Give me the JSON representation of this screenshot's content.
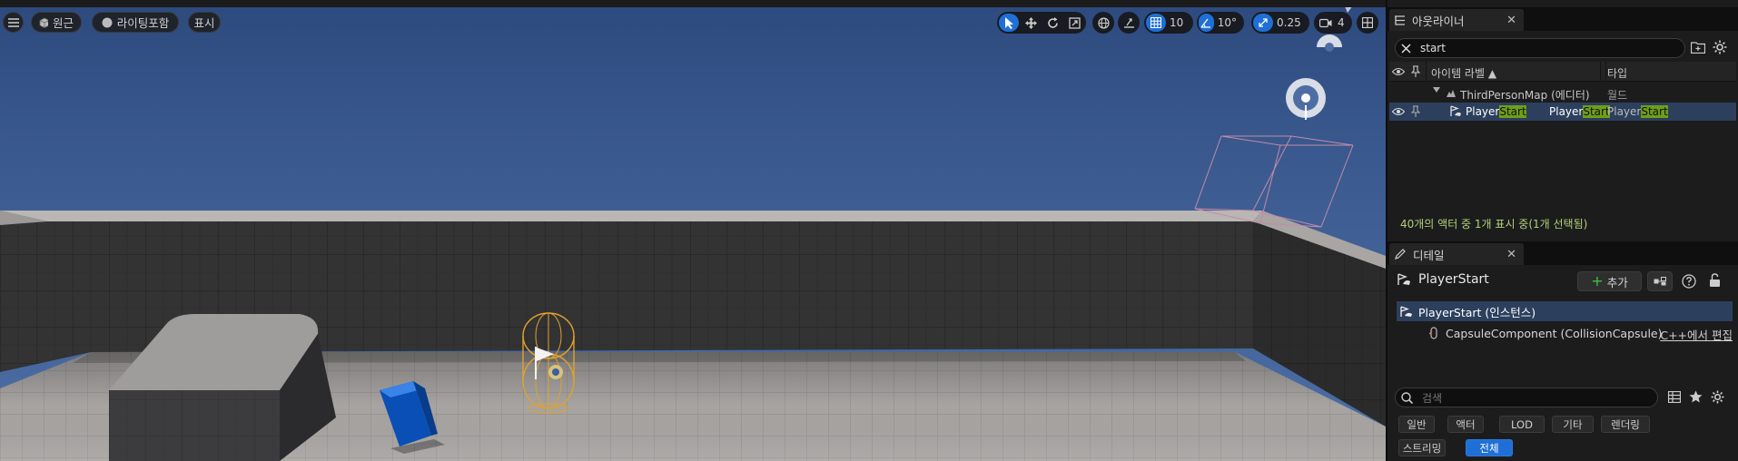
{
  "viewport": {
    "perspective_label": "원근",
    "lighting_label": "라이팅포함",
    "show_label": "표시",
    "grid_snap_value": "10",
    "rotation_snap_value": "10°",
    "scale_snap_value": "0.25",
    "camera_speed_value": "4"
  },
  "outliner": {
    "tab_label": "아웃라이너",
    "close_glyph": "✕",
    "search_value": "start",
    "columns": {
      "label": "아이템 라벨 ▲",
      "type": "타입"
    },
    "world_row": {
      "label": "ThirdPersonMap (에디터)",
      "type": "월드"
    },
    "selected_row": {
      "label_prefix": "Player",
      "label_highlight": "Start",
      "col2_prefix": "Player",
      "col2_highlight": "Start",
      "type_prefix": "Player",
      "type_highlight": "Start"
    },
    "status": "40개의 액터 중 1개 표시 중(1개 선택됨)"
  },
  "details": {
    "tab_label": "디테일",
    "close_glyph": "✕",
    "actor_name": "PlayerStart",
    "add_label": "추가",
    "instance_row": "PlayerStart (인스턴스)",
    "component_row": "CapsuleComponent (CollisionCapsule)",
    "edit_cpp_link": "C++에서 편집",
    "search_placeholder": "검색",
    "categories_row1": [
      "일반",
      "액터",
      "LOD",
      "기타",
      "렌더링"
    ],
    "categories_row2": [
      "스트리밍",
      "전체"
    ]
  },
  "colors": {
    "accent": "#1f6fd6",
    "highlight": "#6e9f16",
    "selection": "#2c3f5d",
    "status_text": "#b2d27a"
  }
}
